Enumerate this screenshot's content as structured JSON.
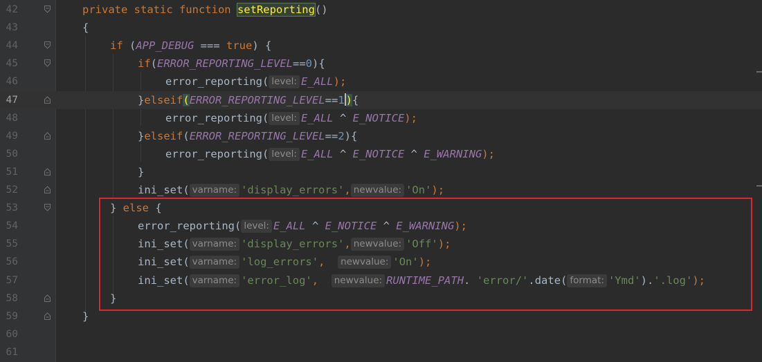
{
  "editor": {
    "lines": [
      {
        "num": "42",
        "tokens": [
          {
            "t": "private static function ",
            "c": "kw"
          },
          {
            "t": "setReporting",
            "c": "hl-fn"
          },
          {
            "t": "()",
            "c": "plain"
          }
        ]
      },
      {
        "num": "43",
        "tokens": [
          {
            "t": "{",
            "c": "plain"
          }
        ]
      },
      {
        "num": "44",
        "tokens": [
          {
            "t": "if",
            "c": "kw"
          },
          {
            "t": " (",
            "c": "plain"
          },
          {
            "t": "APP_DEBUG",
            "c": "const"
          },
          {
            "t": " === ",
            "c": "plain"
          },
          {
            "t": "true",
            "c": "kw"
          },
          {
            "t": ") {",
            "c": "plain"
          }
        ]
      },
      {
        "num": "45",
        "tokens": [
          {
            "t": "if",
            "c": "kw"
          },
          {
            "t": "(",
            "c": "plain"
          },
          {
            "t": "ERROR_REPORTING_LEVEL",
            "c": "const"
          },
          {
            "t": "==",
            "c": "plain"
          },
          {
            "t": "0",
            "c": "num"
          },
          {
            "t": "){",
            "c": "plain"
          }
        ]
      },
      {
        "num": "46",
        "tokens": [
          {
            "t": "error_reporting(",
            "c": "plain"
          },
          {
            "t": "level:",
            "c": "hint"
          },
          {
            "t": "E_ALL",
            "c": "const"
          },
          {
            "t": ");",
            "c": "kw"
          }
        ]
      },
      {
        "num": "47",
        "tokens": [
          {
            "t": "}",
            "c": "plain"
          },
          {
            "t": "elseif",
            "c": "kw"
          },
          {
            "t": "(",
            "c": "brace-hl"
          },
          {
            "t": "ERROR_REPORTING_LEVEL",
            "c": "const"
          },
          {
            "t": "==",
            "c": "plain"
          },
          {
            "t": "1",
            "c": "num"
          },
          {
            "t": ")",
            "c": "brace-hl"
          },
          {
            "t": "{",
            "c": "plain"
          }
        ]
      },
      {
        "num": "48",
        "tokens": [
          {
            "t": "error_reporting(",
            "c": "plain"
          },
          {
            "t": "level:",
            "c": "hint"
          },
          {
            "t": "E_ALL",
            "c": "const"
          },
          {
            "t": " ^ ",
            "c": "plain"
          },
          {
            "t": "E_NOTICE",
            "c": "const"
          },
          {
            "t": ");",
            "c": "kw"
          }
        ]
      },
      {
        "num": "49",
        "tokens": [
          {
            "t": "}",
            "c": "plain"
          },
          {
            "t": "elseif",
            "c": "kw"
          },
          {
            "t": "(",
            "c": "plain"
          },
          {
            "t": "ERROR_REPORTING_LEVEL",
            "c": "const"
          },
          {
            "t": "==",
            "c": "plain"
          },
          {
            "t": "2",
            "c": "num"
          },
          {
            "t": "){",
            "c": "plain"
          }
        ]
      },
      {
        "num": "50",
        "tokens": [
          {
            "t": "error_reporting(",
            "c": "plain"
          },
          {
            "t": "level:",
            "c": "hint"
          },
          {
            "t": "E_ALL",
            "c": "const"
          },
          {
            "t": " ^ ",
            "c": "plain"
          },
          {
            "t": "E_NOTICE",
            "c": "const"
          },
          {
            "t": " ^ ",
            "c": "plain"
          },
          {
            "t": "E_WARNING",
            "c": "const"
          },
          {
            "t": ");",
            "c": "kw"
          }
        ]
      },
      {
        "num": "51",
        "tokens": [
          {
            "t": "}",
            "c": "plain"
          }
        ]
      },
      {
        "num": "52",
        "tokens": [
          {
            "t": "ini_set(",
            "c": "plain"
          },
          {
            "t": "varname:",
            "c": "hint"
          },
          {
            "t": "'display_errors'",
            "c": "str"
          },
          {
            "t": ",",
            "c": "kw"
          },
          {
            "t": "newvalue:",
            "c": "hint"
          },
          {
            "t": "'On'",
            "c": "str"
          },
          {
            "t": ");",
            "c": "kw"
          }
        ]
      },
      {
        "num": "53",
        "tokens": [
          {
            "t": "} ",
            "c": "plain"
          },
          {
            "t": "else",
            "c": "kw"
          },
          {
            "t": " {",
            "c": "plain"
          }
        ]
      },
      {
        "num": "54",
        "tokens": [
          {
            "t": "error_reporting(",
            "c": "plain"
          },
          {
            "t": "level:",
            "c": "hint"
          },
          {
            "t": "E_ALL",
            "c": "const"
          },
          {
            "t": " ^ ",
            "c": "plain"
          },
          {
            "t": "E_NOTICE",
            "c": "const"
          },
          {
            "t": " ^ ",
            "c": "plain"
          },
          {
            "t": "E_WARNING",
            "c": "const"
          },
          {
            "t": ");",
            "c": "kw"
          }
        ]
      },
      {
        "num": "55",
        "tokens": [
          {
            "t": "ini_set(",
            "c": "plain"
          },
          {
            "t": "varname:",
            "c": "hint"
          },
          {
            "t": "'display_errors'",
            "c": "str"
          },
          {
            "t": ",",
            "c": "kw"
          },
          {
            "t": "newvalue:",
            "c": "hint"
          },
          {
            "t": "'Off'",
            "c": "str"
          },
          {
            "t": ");",
            "c": "kw"
          }
        ]
      },
      {
        "num": "56",
        "tokens": [
          {
            "t": "ini_set(",
            "c": "plain"
          },
          {
            "t": "varname:",
            "c": "hint"
          },
          {
            "t": "'log_errors'",
            "c": "str"
          },
          {
            "t": ",  ",
            "c": "kw"
          },
          {
            "t": "newvalue:",
            "c": "hint"
          },
          {
            "t": "'On'",
            "c": "str"
          },
          {
            "t": ");",
            "c": "kw"
          }
        ]
      },
      {
        "num": "57",
        "tokens": [
          {
            "t": "ini_set(",
            "c": "plain"
          },
          {
            "t": "varname:",
            "c": "hint"
          },
          {
            "t": "'error_log'",
            "c": "str"
          },
          {
            "t": ",  ",
            "c": "kw"
          },
          {
            "t": "newvalue:",
            "c": "hint"
          },
          {
            "t": "RUNTIME_PATH",
            "c": "const"
          },
          {
            "t": ". ",
            "c": "plain"
          },
          {
            "t": "'error/'",
            "c": "str"
          },
          {
            "t": ".date(",
            "c": "plain"
          },
          {
            "t": "format:",
            "c": "hint"
          },
          {
            "t": "'Ymd'",
            "c": "str"
          },
          {
            "t": ").",
            "c": "plain"
          },
          {
            "t": "'.log'",
            "c": "str"
          },
          {
            "t": ");",
            "c": "kw"
          }
        ]
      },
      {
        "num": "58",
        "tokens": [
          {
            "t": "}",
            "c": "plain"
          }
        ]
      },
      {
        "num": "59",
        "tokens": [
          {
            "t": "}",
            "c": "plain"
          }
        ]
      },
      {
        "num": "60",
        "tokens": []
      },
      {
        "num": "61",
        "tokens": []
      }
    ]
  },
  "colors": {
    "background": "#2b2b2b",
    "gutter": "#313335",
    "keyword": "#cc7832",
    "constant": "#9876aa",
    "string": "#6a8759",
    "number": "#6897bb",
    "annotation_box": "#e0262f"
  }
}
